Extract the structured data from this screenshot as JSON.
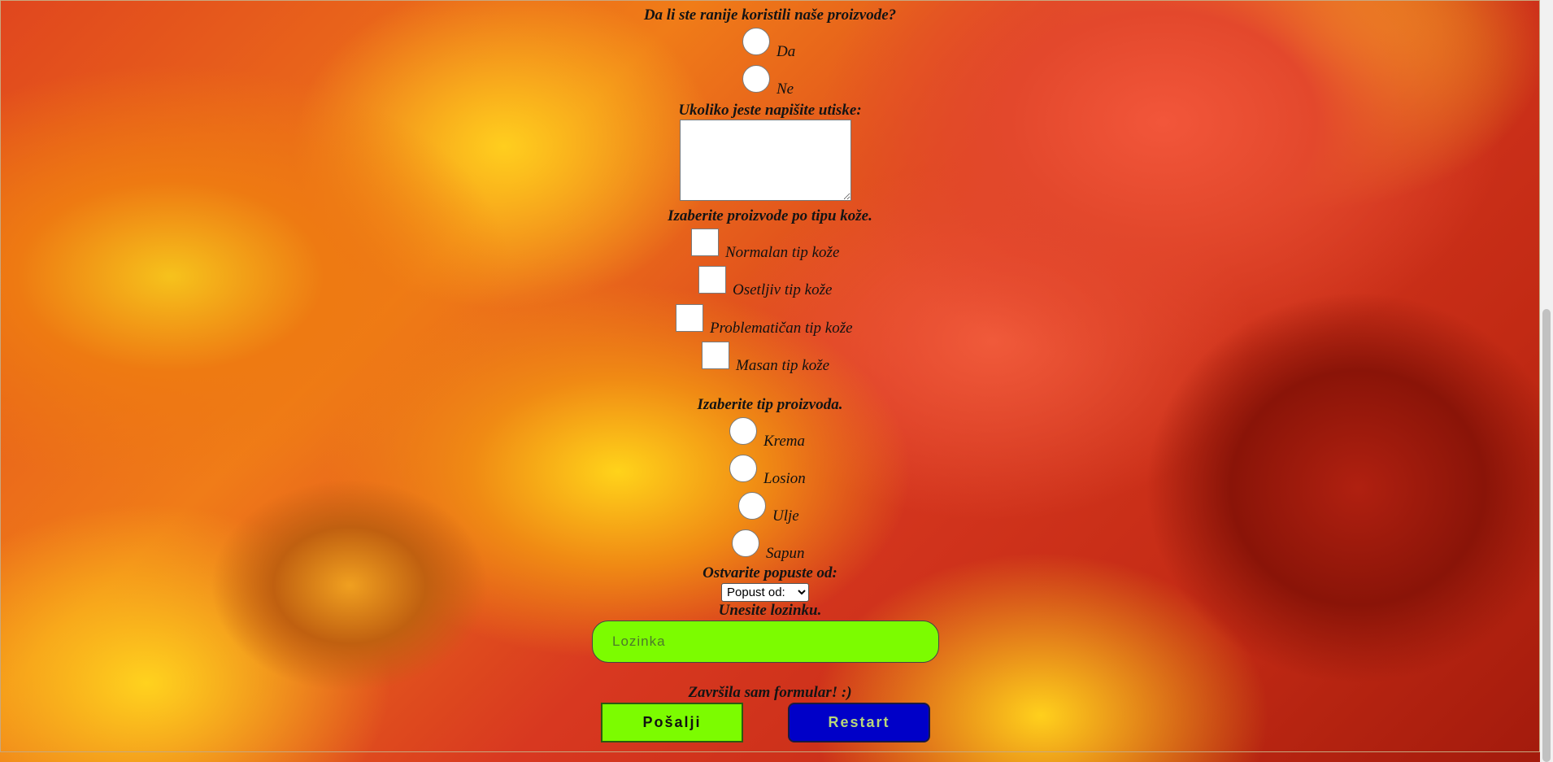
{
  "form": {
    "q_used_before": "Da li ste ranije koristili naše proizvode?",
    "used_options": [
      "Da",
      "Ne"
    ],
    "q_comment": "Ukoliko jeste napišite utiske:",
    "comment_value": "",
    "q_skin_type": "Izaberite proizvode po tipu kože.",
    "skin_types": [
      "Normalan tip kože",
      "Osetljiv tip kože",
      "Problematičan tip kože",
      "Masan tip kože"
    ],
    "q_product_type": "Izaberite tip proizvoda.",
    "product_types": [
      "Krema",
      "Losion",
      "Ulje",
      "Sapun"
    ],
    "q_discount": "Ostvarite popuste od:",
    "discount_selected": "Popust od:",
    "q_password": "Unesite lozinku.",
    "password_placeholder": "Lozinka",
    "q_done": "Završila sam formular! :)",
    "submit_label": "Pošalji",
    "reset_label": "Restart"
  },
  "colors": {
    "submit_bg": "#7cfc00",
    "reset_bg": "#0000c8",
    "password_bg": "#7cfc00"
  }
}
